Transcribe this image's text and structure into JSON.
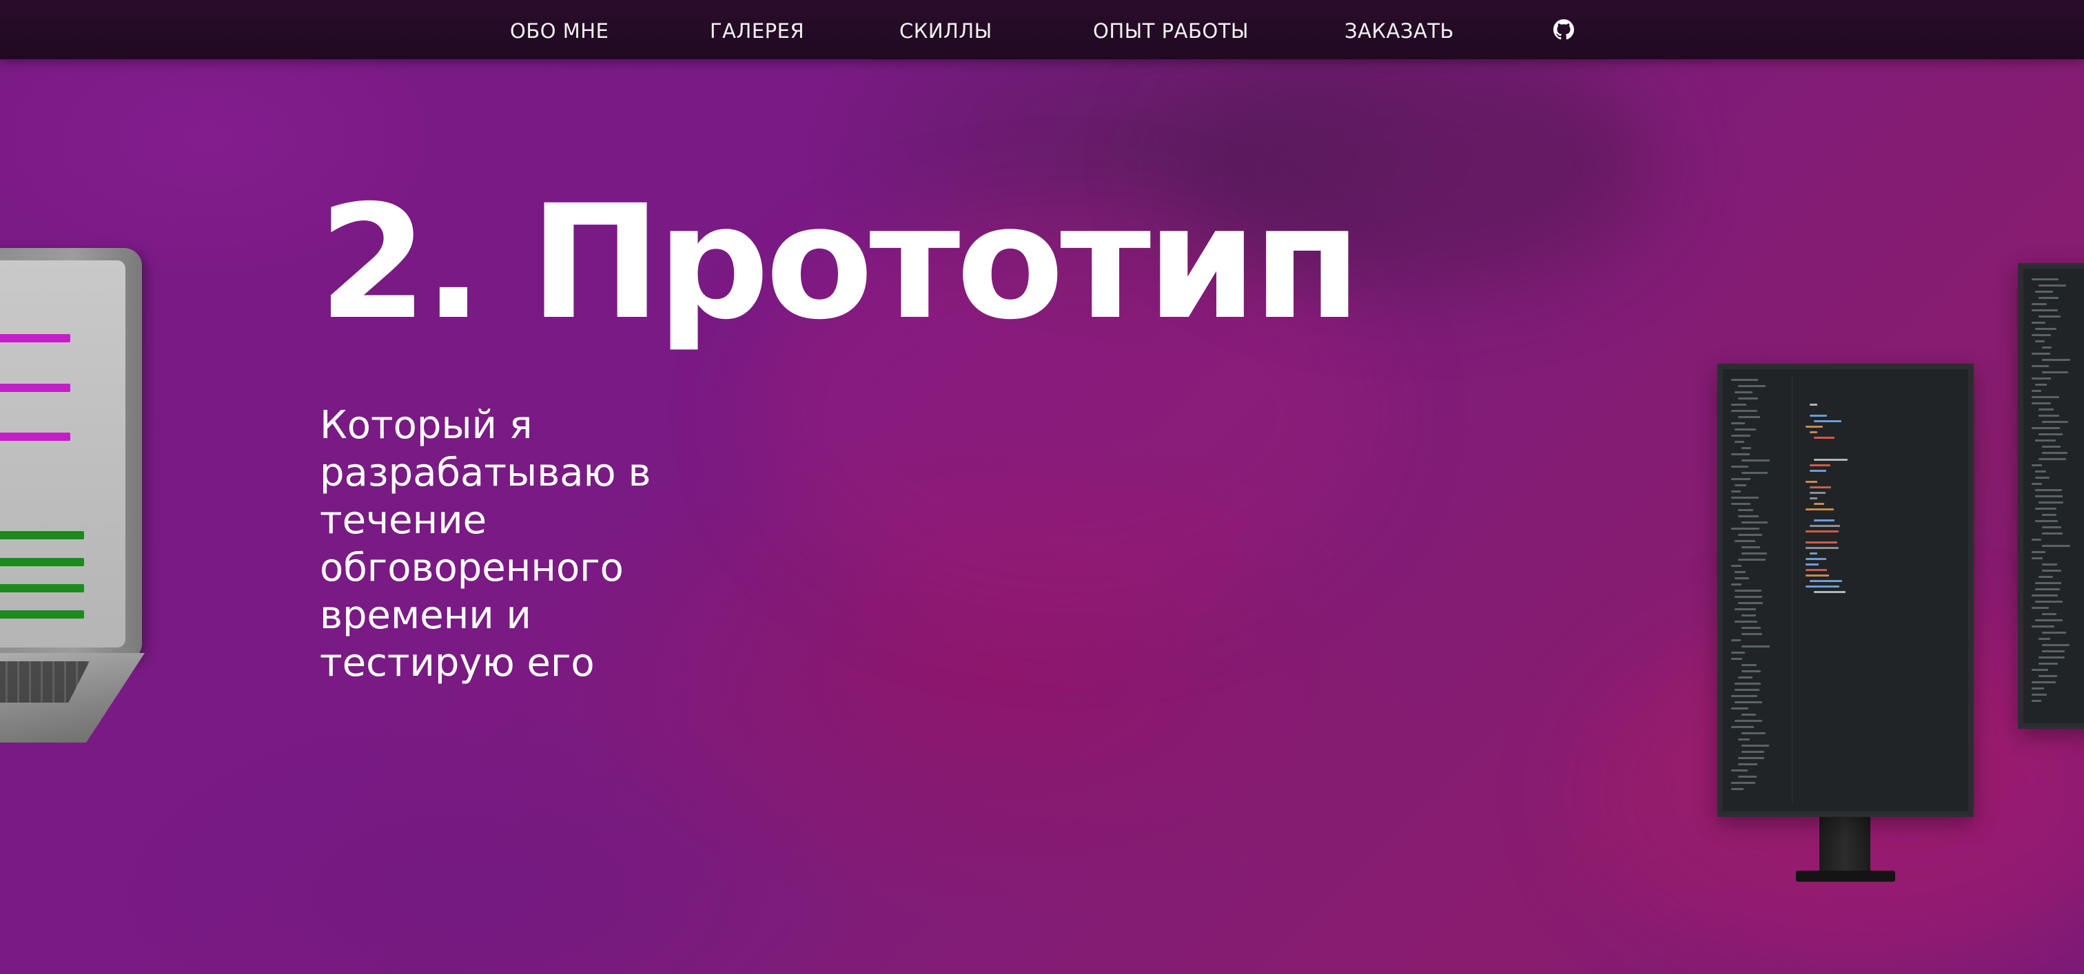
{
  "nav": {
    "items": [
      {
        "label": "ОБО МНЕ"
      },
      {
        "label": "ГАЛЕРЕЯ"
      },
      {
        "label": "СКИЛЛЫ"
      },
      {
        "label": "ОПЫТ РАБОТЫ"
      },
      {
        "label": "ЗАКАЗАТЬ"
      }
    ],
    "github_icon": "github-icon"
  },
  "hero": {
    "title": "2. Прототип",
    "description": "Который я разрабатываю в течение обговоренного времени и тестирую его"
  },
  "colors": {
    "nav_background": "#220b24",
    "page_background": "#7b1b86",
    "accent_magenta": "#c020c8",
    "accent_green": "#1f8a1f",
    "text": "#ffffff"
  }
}
